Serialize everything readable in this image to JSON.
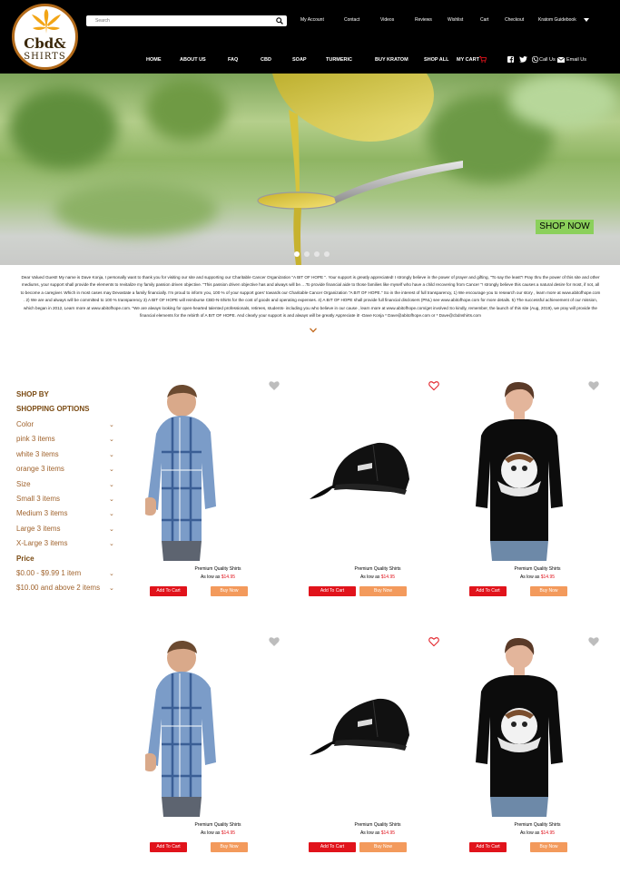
{
  "brand": {
    "logo_line1": "Cbd&",
    "logo_line2": "SHIRTS"
  },
  "search": {
    "placeholder": "Search"
  },
  "top_links": [
    "My Account",
    "Contact",
    "Videos",
    "Reviews",
    "Wishlist",
    "Cart",
    "Checkout",
    "Kratom Guidebook"
  ],
  "nav": [
    "HOME",
    "ABOUT US",
    "FAQ",
    "CBD",
    "SOAP",
    "TURMERIC",
    "BUY KRATOM",
    "SHOP ALL",
    "MY CART"
  ],
  "contact": {
    "call": "Call Us",
    "email": "Email Us"
  },
  "hero": {
    "button": "SHOP NOW",
    "active_slide": 1,
    "slides": 4
  },
  "intro_text": "Dear Valued Guest! My name is Dave Konja, I personally want to thank you for visiting our site and supporting our Charitable Cancer Organization \"A BIT OF HOPE \". Your support is greatly appreciated! I strongly believe in the power of prayer and gifting, \"To say the least\"! Pray thru the power of this site and other mediums, your support shall provide the elements to revitalize my family passion driven objective. \"This passion driven objective has and always will be….To provide financial aide to those families like myself who have a child recovering from Cancer \"! strongly believe this causes a natural desire for most, if not, all to become a caregiver. Which in most cases may Devastate a family financially. I'm proud to inform you, 100 % of your support goes' towards our Charitable Cancer Organization \"A BIT OF HOPE.\" So in the interest of full transparency, 1) We encourage you to research our story , learn more at www.abitofhope.com . 2) We are and always will be committed to 100 % transparency 3) A BIT OF HOPE will reimburse CBD-N-Shirts for the cost of goods and operating expenses. 4) A BIT OF HOPE shall provide full financial disclosers (PNL) see www.abitofhope.com for more details. 5) The successful achievement of our mission, which began in 2012, Learn more at www.abitofhope.com. \"We are always looking for open-hearted talented professionals, retirees, students- including you who believe in our cause , learn more at www.abitofhope.com/get involved So kindly, remember, the launch of this site (Aug, 2019), we pray will provide the financial elements for the rebirth of A BIT OF HOPE. And clearly your support is and always will be greatly Appreciate it! -Dave Konja * Dave@abitofhope.com or * Dave@cbdnshirts.com",
  "sidebar": {
    "shop_by": "SHOP BY",
    "shopping_options": "SHOPPING OPTIONS",
    "items": [
      {
        "label": "Color",
        "chev": true
      },
      {
        "label": "pink 3 items",
        "chev": true
      },
      {
        "label": "white 3 items",
        "chev": true
      },
      {
        "label": "orange 3 items",
        "chev": true
      },
      {
        "label": "Size",
        "chev": true
      },
      {
        "label": "Small 3 items",
        "chev": true
      },
      {
        "label": "Medium 3 items",
        "chev": true
      },
      {
        "label": "Large 3 items",
        "chev": true
      },
      {
        "label": "X-Large 3 items",
        "chev": true
      },
      {
        "label": "Price",
        "chev": false,
        "bold": true
      },
      {
        "label": "$0.00 - $9.99 1 item",
        "chev": true
      },
      {
        "label": "$10.00 and above 2 items",
        "chev": true
      }
    ]
  },
  "products": [
    {
      "title": "Premium Quality Shirts",
      "price_prefix": "As low as",
      "price": "$14.95",
      "add": "Add To Cart",
      "buy": "Buy Now",
      "kind": "shirt",
      "heart": "filled"
    },
    {
      "title": "Premium Quality Shirts",
      "price_prefix": "As low as",
      "price": "$14.95",
      "add": "Add To Cart",
      "buy": "Buy Now",
      "kind": "cap",
      "heart": "outline"
    },
    {
      "title": "Premium Quality Shirts",
      "price_prefix": "As low as",
      "price": "$14.95",
      "add": "Add To Cart",
      "buy": "Buy Now",
      "kind": "tee",
      "heart": "filled"
    },
    {
      "title": "Premium Quality Shirts",
      "price_prefix": "As low as",
      "price": "$14.95",
      "add": "Add To Cart",
      "buy": "Buy Now",
      "kind": "shirt",
      "heart": "filled"
    },
    {
      "title": "Premium Quality Shirts",
      "price_prefix": "As low as",
      "price": "$14.95",
      "add": "Add To Cart",
      "buy": "Buy Now",
      "kind": "cap",
      "heart": "outline"
    },
    {
      "title": "Premium Quality Shirts",
      "price_prefix": "As low as",
      "price": "$14.95",
      "add": "Add To Cart",
      "buy": "Buy Now",
      "kind": "tee",
      "heart": "filled"
    }
  ],
  "colors": {
    "header": "#000000",
    "sidebar_heading": "#7a4a12",
    "sidebar_item": "#a0632d",
    "price": "#e0121b",
    "add_to_cart": "#e1131b",
    "buy_now": "#f39a5c",
    "shop_now": "#8bd05b"
  }
}
